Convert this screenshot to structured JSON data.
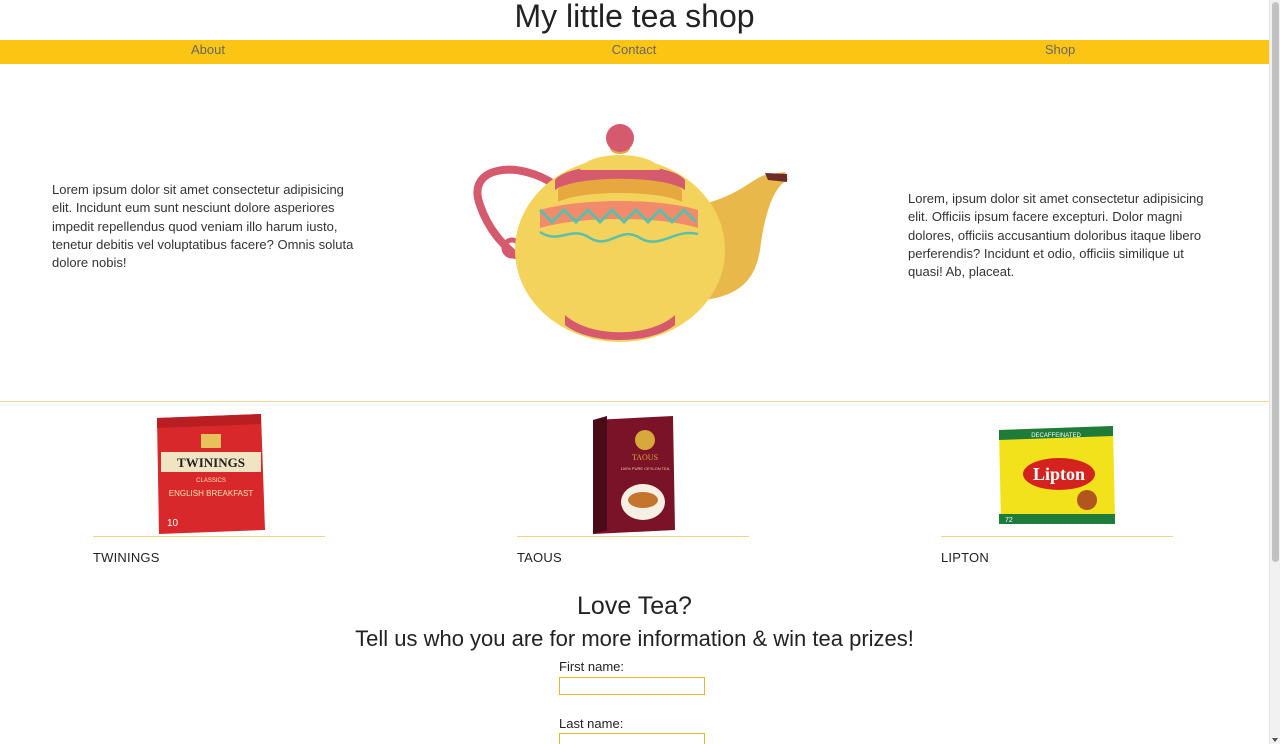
{
  "site": {
    "title": "My little tea shop"
  },
  "nav": {
    "items": [
      {
        "label": "About"
      },
      {
        "label": "Contact"
      },
      {
        "label": "Shop"
      }
    ],
    "bg_color": "#fdc513"
  },
  "hero": {
    "left_text": "Lorem ipsum dolor sit amet consectetur adipisicing elit. Incidunt eum sunt nesciunt dolore asperiores impedit repellendus quod veniam illo harum iusto, tenetur debitis vel voluptatibus facere? Omnis soluta dolore nobis!",
    "right_text": "Lorem, ipsum dolor sit amet consectetur adipisicing elit. Officiis ipsum facere excepturi. Dolor magni dolores, officiis accusantium doloribus itaque libero perferendis? Incidunt et odio, officiis similique ut quasi! Ab, placeat.",
    "image_icon": "teapot-illustration"
  },
  "products": [
    {
      "name": "TWININGS",
      "box_text": "TWININGS",
      "box_subtext": "ENGLISH BREAKFAST",
      "box_tag": "CLASSICS",
      "box_count": "10",
      "box_color": "#d8282b"
    },
    {
      "name": "TAOUS",
      "box_text": "TAOUS",
      "box_subtext": "100% PURE CEYLON TEA",
      "box_color": "#7a1228"
    },
    {
      "name": "LIPTON",
      "box_text": "Lipton",
      "box_subtext": "DECAFFEINATED",
      "box_count": "72",
      "box_color": "#f2e21c"
    }
  ],
  "signup": {
    "heading": "Love Tea?",
    "subheading": "Tell us who you are for more information & win tea prizes!",
    "first_name_label": "First name:",
    "first_name_value": "",
    "last_name_label": "Last name:",
    "last_name_value": ""
  }
}
